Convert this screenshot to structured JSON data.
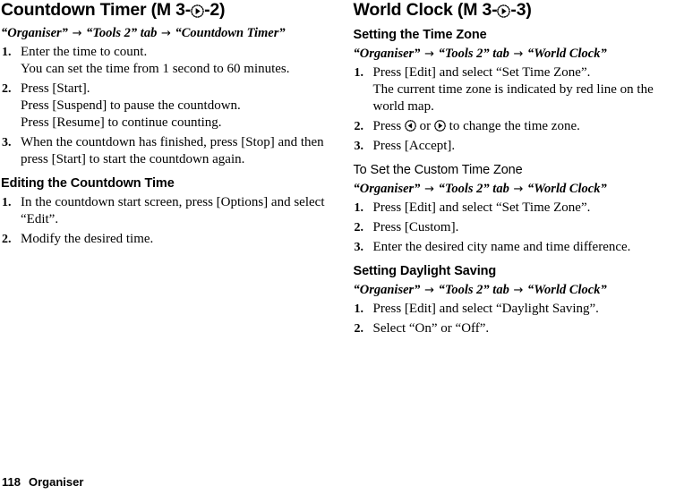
{
  "page": {
    "footer_page_number": "118",
    "footer_section": "Organiser"
  },
  "icons": {
    "right_key": "right-direction-key-icon",
    "left_key": "left-direction-key-icon"
  },
  "left_column": {
    "title_prefix": "Countdown Timer (M 3-",
    "title_suffix": "-2)",
    "path": {
      "part1": "“Organiser”",
      "arrow1": "→",
      "part2": "“Tools 2” tab",
      "arrow2": "→",
      "part3": "“Countdown Timer”"
    },
    "steps": [
      {
        "num": "1.",
        "text": "Enter the time to count.",
        "note": "You can set the time from 1 second to 60 minutes."
      },
      {
        "num": "2.",
        "text": "Press [Start].",
        "note": "Press [Suspend] to pause the countdown.",
        "note2": "Press [Resume] to continue counting."
      },
      {
        "num": "3.",
        "text": "When the countdown has finished, press [Stop] and then press [Start] to start the countdown again."
      }
    ],
    "section2": {
      "heading": "Editing the Countdown Time",
      "steps": [
        {
          "num": "1.",
          "text": "In the countdown start screen, press [Options] and select “Edit”."
        },
        {
          "num": "2.",
          "text": "Modify the desired time."
        }
      ]
    }
  },
  "right_column": {
    "title_prefix": "World Clock (M 3-",
    "title_suffix": "-3)",
    "section1": {
      "heading": "Setting the Time Zone",
      "path": {
        "part1": "“Organiser”",
        "arrow1": "→",
        "part2": "“Tools 2” tab",
        "arrow2": "→",
        "part3": "“World Clock”"
      },
      "step1": {
        "num": "1.",
        "text": "Press [Edit] and select “Set Time Zone”.",
        "note": "The current time zone is indicated by red line on the world map."
      },
      "step2": {
        "num": "2.",
        "text_before": "Press",
        "text_middle": "or",
        "text_after": "to change the time zone."
      },
      "step3": {
        "num": "3.",
        "text": "Press [Accept]."
      }
    },
    "section2": {
      "heading": "To Set the Custom Time Zone",
      "path": {
        "part1": "“Organiser”",
        "arrow1": "→",
        "part2": "“Tools 2” tab",
        "arrow2": "→",
        "part3": "“World Clock”"
      },
      "steps": [
        {
          "num": "1.",
          "text": "Press [Edit] and select “Set Time Zone”."
        },
        {
          "num": "2.",
          "text": "Press [Custom]."
        },
        {
          "num": "3.",
          "text": "Enter the desired city name and time difference."
        }
      ]
    },
    "section3": {
      "heading": "Setting Daylight Saving",
      "path": {
        "part1": "“Organiser”",
        "arrow1": "→",
        "part2": "“Tools 2” tab",
        "arrow2": "→",
        "part3": "“World Clock”"
      },
      "steps": [
        {
          "num": "1.",
          "text": "Press [Edit] and select “Daylight Saving”."
        },
        {
          "num": "2.",
          "text": "Select “On” or “Off”."
        }
      ]
    }
  }
}
